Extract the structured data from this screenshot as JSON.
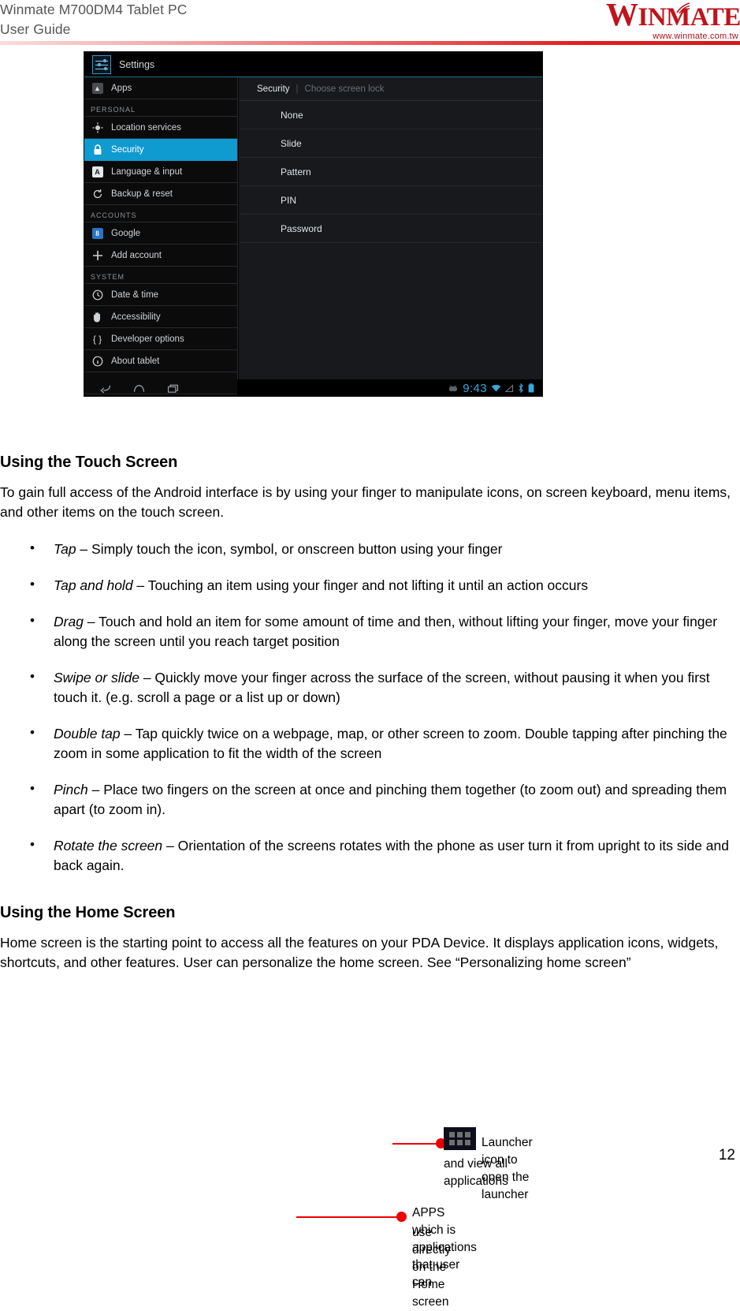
{
  "header": {
    "title_line1": "Winmate M700DM4 Tablet PC",
    "title_line2": "User Guide",
    "logo_text_w": "W",
    "logo_text_rest": "INMATE",
    "logo_url": "www.winmate.com.tw",
    "brand_color": "#c0131b",
    "rule_color": "#e21f20"
  },
  "screenshot": {
    "app_title": "Settings",
    "app_icon": "settings-sliders-icon",
    "sidebar": [
      {
        "type": "item",
        "label": "Apps",
        "icon": "apps-icon",
        "selected": false
      },
      {
        "type": "header",
        "label": "PERSONAL"
      },
      {
        "type": "item",
        "label": "Location services",
        "icon": "location-icon",
        "selected": false
      },
      {
        "type": "item",
        "label": "Security",
        "icon": "lock-icon",
        "selected": true
      },
      {
        "type": "item",
        "label": "Language & input",
        "icon": "language-icon",
        "selected": false
      },
      {
        "type": "item",
        "label": "Backup & reset",
        "icon": "backup-reset-icon",
        "selected": false
      },
      {
        "type": "header",
        "label": "ACCOUNTS"
      },
      {
        "type": "item",
        "label": "Google",
        "icon": "google-icon",
        "selected": false
      },
      {
        "type": "item",
        "label": "Add account",
        "icon": "plus-icon",
        "selected": false
      },
      {
        "type": "header",
        "label": "SYSTEM"
      },
      {
        "type": "item",
        "label": "Date & time",
        "icon": "clock-icon",
        "selected": false
      },
      {
        "type": "item",
        "label": "Accessibility",
        "icon": "hand-icon",
        "selected": false
      },
      {
        "type": "item",
        "label": "Developer options",
        "icon": "braces-icon",
        "selected": false
      },
      {
        "type": "item",
        "label": "About tablet",
        "icon": "info-icon",
        "selected": false
      }
    ],
    "breadcrumb": {
      "primary": "Security",
      "secondary": "Choose screen lock"
    },
    "lock_options": [
      "None",
      "Slide",
      "Pattern",
      "PIN",
      "Password"
    ],
    "navbar": {
      "back_icon": "back-arrow-icon",
      "home_icon": "home-icon",
      "recents_icon": "recent-apps-icon"
    },
    "statusbar": {
      "android_icon": "android-robot-icon",
      "clock": "9:43",
      "wifi_icon": "wifi-icon",
      "signal_icon": "signal-icon",
      "bluetooth_icon": "bluetooth-icon",
      "battery_icon": "battery-icon",
      "accent_color": "#3aa7dc"
    },
    "selected_color": "#0f9ad0"
  },
  "sections": {
    "touch": {
      "heading": "Using the Touch Screen",
      "intro": "To gain full access of the Android interface is by using your finger to manipulate icons, on screen keyboard, menu items, and other items on the touch screen.",
      "gestures": [
        {
          "term": "Tap",
          "desc": " – Simply touch the icon, symbol, or onscreen button using your finger"
        },
        {
          "term": "Tap and hold",
          "desc": " – Touching an item using your finger and not lifting it until an action occurs"
        },
        {
          "term": "Drag",
          "desc": " – Touch and hold an item for some amount of time and then, without lifting your finger, move your finger along the screen until you reach target position"
        },
        {
          "term": "Swipe or slide",
          "desc": " – Quickly move your finger across the surface of the screen, without pausing it when you first touch it. (e.g. scroll a page or a list up or down)"
        },
        {
          "term": "Double tap",
          "desc": " – Tap quickly twice on a webpage, map, or other screen to zoom. Double tapping after pinching the zoom in some application to fit the width of the screen"
        },
        {
          "term": "Pinch",
          "desc": " – Place two fingers on the screen at once and pinching them together (to zoom out) and spreading them apart (to zoom in)."
        },
        {
          "term": "Rotate the screen",
          "desc": " – Orientation of the screens rotates with the phone as user turn it from upright to its side and back again."
        }
      ]
    },
    "home": {
      "heading": "Using the Home Screen",
      "intro": "Home screen is the starting point to access all the features on your PDA Device. It displays application icons, widgets, shortcuts, and other features. User can personalize the home screen. See “Personalizing home screen”"
    }
  },
  "callouts": [
    {
      "icon": "launcher-grid-icon",
      "line1": "Launcher icon to open the launcher",
      "line2": "and view all applications"
    },
    {
      "line1": "APPS  which is applications that user can",
      "line2": "use directly on the Home screen"
    }
  ],
  "footer": {
    "page_number": "12"
  }
}
